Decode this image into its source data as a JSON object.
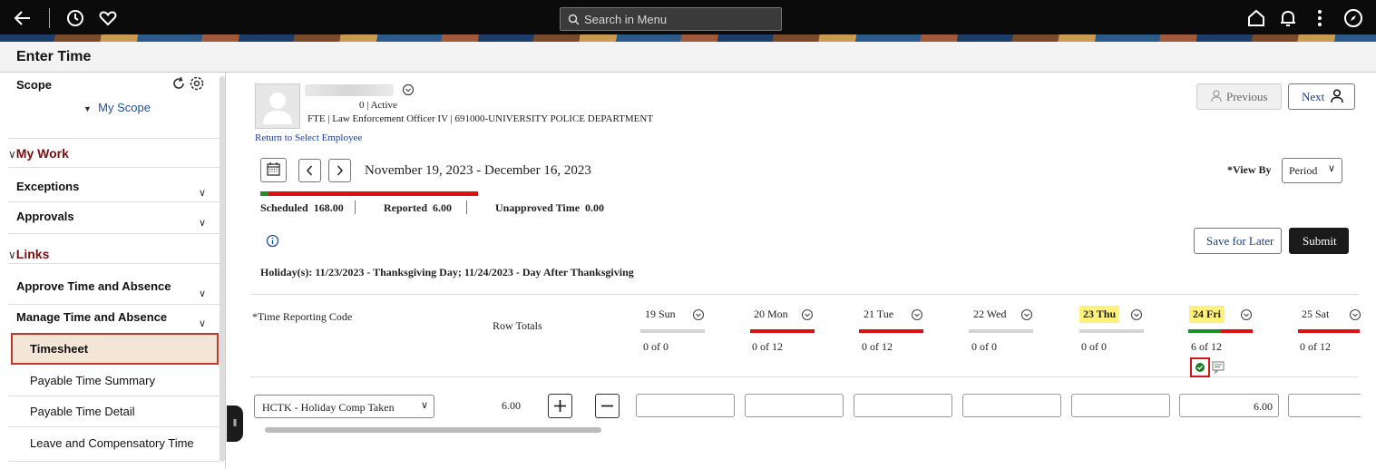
{
  "topbar": {
    "search_placeholder": "Search in Menu",
    "icons": [
      "back-arrow-icon",
      "history-icon",
      "favorites-heart-icon",
      "home-icon",
      "notifications-bell-icon",
      "more-actions-icon",
      "navbar-compass-icon"
    ]
  },
  "page": {
    "title": "Enter Time"
  },
  "sidebar": {
    "scope_label": "Scope",
    "my_scope": "My Scope",
    "my_work": "My Work",
    "exceptions": "Exceptions",
    "approvals": "Approvals",
    "links": "Links",
    "approve_time": "Approve Time and Absence",
    "manage_time": "Manage Time and Absence",
    "items": [
      {
        "label": "Timesheet"
      },
      {
        "label": "Payable Time Summary"
      },
      {
        "label": "Payable Time Detail"
      },
      {
        "label": "Leave and Compensatory Time"
      }
    ]
  },
  "employee": {
    "status": "0 | Active",
    "details": "FTE | Law Enforcement Officer IV | 691000-UNIVERSITY POLICE DEPARTMENT",
    "return_link": "Return to Select Employee"
  },
  "nav": {
    "previous": "Previous",
    "next": "Next"
  },
  "period": {
    "range": "November 19, 2023 - December 16, 2023",
    "view_by_label": "*View By",
    "view_by_value": "Period"
  },
  "summary": {
    "scheduled_label": "Scheduled",
    "scheduled_value": "168.00",
    "reported_label": "Reported",
    "reported_value": "6.00",
    "unapproved_label": "Unapproved Time",
    "unapproved_value": "0.00"
  },
  "actions": {
    "save_for_later": "Save for Later",
    "submit": "Submit"
  },
  "holiday_text": "Holiday(s): 11/23/2023 - Thanksgiving Day; 11/24/2023 - Day After Thanksgiving",
  "grid": {
    "trc_header": "*Time Reporting Code",
    "row_totals_header": "Row Totals",
    "days": [
      {
        "label": "19 Sun",
        "hours": "0 of 0",
        "bar": "#d4d4d4"
      },
      {
        "label": "20 Mon",
        "hours": "0 of 12",
        "bar": "#e01010"
      },
      {
        "label": "21 Tue",
        "hours": "0 of 12",
        "bar": "#e01010"
      },
      {
        "label": "22 Wed",
        "hours": "0 of 0",
        "bar": "#d4d4d4"
      },
      {
        "label": "23 Thu",
        "hours": "0 of 0",
        "bar": "#d4d4d4",
        "highlight": "#fff27a"
      },
      {
        "label": "24 Fri",
        "hours": "6 of 12",
        "bar": "#e01010",
        "highlight": "#fff27a"
      },
      {
        "label": "25 Sat",
        "hours": "0 of 12",
        "bar": "#e01010"
      }
    ],
    "row": {
      "trc_value": "HCTK - Holiday Comp Taken",
      "total": "6.00",
      "fri_value": "6.00"
    }
  }
}
